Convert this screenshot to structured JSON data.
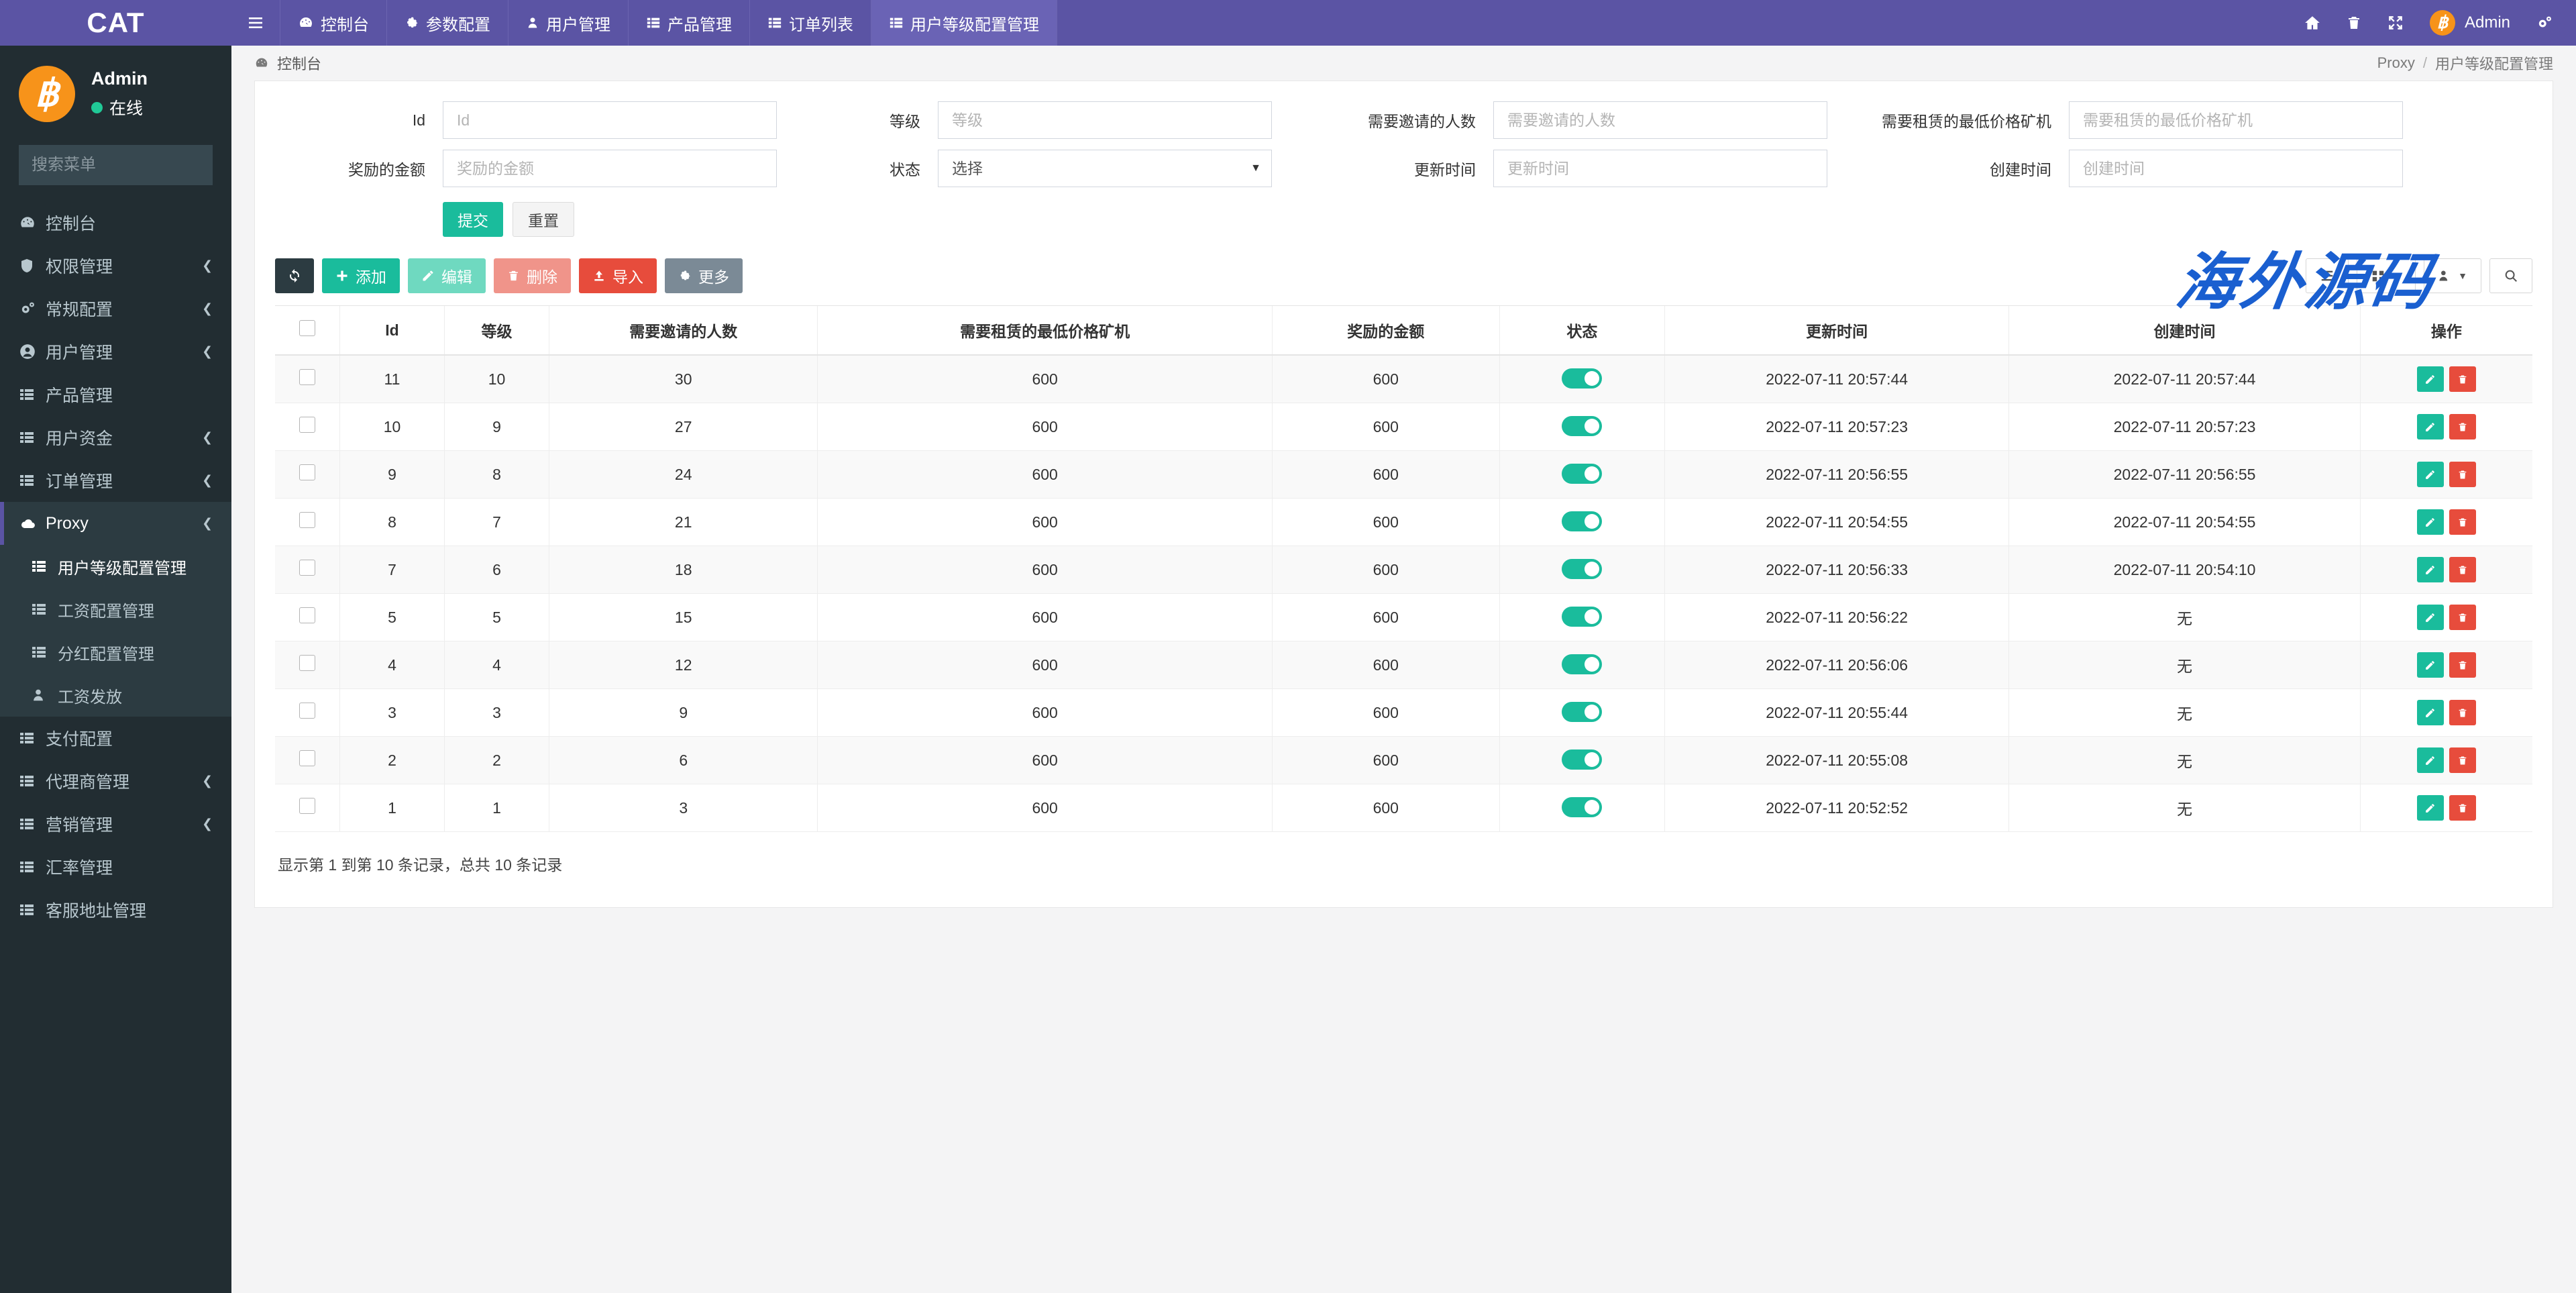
{
  "brand": {
    "title": "CAT"
  },
  "sidebar": {
    "user": {
      "name": "Admin",
      "status": "在线",
      "avatar_icon": "bitcoin-icon"
    },
    "search": {
      "placeholder": "搜索菜单",
      "value": "",
      "icon": "search-icon"
    },
    "items": [
      {
        "label": "控制台",
        "icon": "dashboard-icon",
        "caret": false,
        "active": false
      },
      {
        "label": "权限管理",
        "icon": "shield-icon",
        "caret": true,
        "active": false
      },
      {
        "label": "常规配置",
        "icon": "gears-icon",
        "caret": true,
        "active": false
      },
      {
        "label": "用户管理",
        "icon": "user-circle-icon",
        "caret": true,
        "active": false
      },
      {
        "label": "产品管理",
        "icon": "list-icon",
        "caret": false,
        "active": false
      },
      {
        "label": "用户资金",
        "icon": "list-icon",
        "caret": true,
        "active": false
      },
      {
        "label": "订单管理",
        "icon": "list-icon",
        "caret": true,
        "active": false
      },
      {
        "label": "Proxy",
        "icon": "cloud-icon",
        "caret": true,
        "active": true
      }
    ],
    "submenu": [
      {
        "label": "用户等级配置管理",
        "icon": "list-icon",
        "active": true
      },
      {
        "label": "工资配置管理",
        "icon": "list-icon",
        "active": false
      },
      {
        "label": "分红配置管理",
        "icon": "list-icon",
        "active": false
      },
      {
        "label": "工资发放",
        "icon": "user-icon",
        "active": false
      }
    ],
    "items_after": [
      {
        "label": "支付配置",
        "icon": "list-icon",
        "caret": false,
        "active": false
      },
      {
        "label": "代理商管理",
        "icon": "list-icon",
        "caret": true,
        "active": false
      },
      {
        "label": "营销管理",
        "icon": "list-icon",
        "caret": true,
        "active": false
      },
      {
        "label": "汇率管理",
        "icon": "list-icon",
        "caret": false,
        "active": false
      },
      {
        "label": "客服地址管理",
        "icon": "list-icon",
        "caret": false,
        "active": false
      }
    ]
  },
  "topbar": {
    "hamburger_icon": "hamburger-icon",
    "nav": [
      {
        "label": "控制台",
        "icon": "dashboard-icon",
        "active": false
      },
      {
        "label": "参数配置",
        "icon": "gear-icon",
        "active": false
      },
      {
        "label": "用户管理",
        "icon": "user-icon",
        "active": false
      },
      {
        "label": "产品管理",
        "icon": "list-icon",
        "active": false
      },
      {
        "label": "订单列表",
        "icon": "list-icon",
        "active": false
      },
      {
        "label": "用户等级配置管理",
        "icon": "list-icon",
        "active": true
      }
    ],
    "right": {
      "home_icon": "home-icon",
      "trash_icon": "trash-icon",
      "fullscreen_icon": "fullscreen-icon",
      "username": "Admin",
      "avatar_icon": "bitcoin-icon",
      "settings_icon": "gears-icon"
    }
  },
  "breadcrumb": {
    "icon": "dashboard-icon",
    "current": "控制台",
    "trail": [
      "Proxy",
      "用户等级配置管理"
    ],
    "separator": "/"
  },
  "search_form": {
    "fields": {
      "id": {
        "label": "Id",
        "placeholder": "Id",
        "value": ""
      },
      "level": {
        "label": "等级",
        "placeholder": "等级",
        "value": ""
      },
      "invite_count": {
        "label": "需要邀请的人数",
        "placeholder": "需要邀请的人数",
        "value": ""
      },
      "min_rent_price": {
        "label": "需要租赁的最低价格矿机",
        "placeholder": "需要租赁的最低价格矿机",
        "value": ""
      },
      "reward_amount": {
        "label": "奖励的金额",
        "placeholder": "奖励的金额",
        "value": ""
      },
      "status": {
        "label": "状态",
        "selected": "选择",
        "options": [
          "选择"
        ]
      },
      "update_time": {
        "label": "更新时间",
        "placeholder": "更新时间",
        "value": ""
      },
      "create_time": {
        "label": "创建时间",
        "placeholder": "创建时间",
        "value": ""
      }
    },
    "submit_label": "提交",
    "reset_label": "重置"
  },
  "watermark": {
    "text": "海外源码",
    "color": "#1a5fd0"
  },
  "toolbar": {
    "refresh": {
      "label": "",
      "icon": "refresh-icon"
    },
    "add": {
      "label": "添加",
      "icon": "plus-icon"
    },
    "edit": {
      "label": "编辑",
      "icon": "pencil-icon"
    },
    "delete": {
      "label": "删除",
      "icon": "trash-icon"
    },
    "import": {
      "label": "导入",
      "icon": "upload-icon"
    },
    "more": {
      "label": "更多",
      "icon": "gear-icon"
    },
    "view_list": {
      "icon": "list-view-icon"
    },
    "columns": {
      "icon": "grid-icon"
    },
    "export": {
      "icon": "person-export-icon"
    },
    "search": {
      "icon": "search-icon"
    }
  },
  "table": {
    "columns": [
      "",
      "Id",
      "等级",
      "需要邀请的人数",
      "需要租赁的最低价格矿机",
      "奖励的金额",
      "状态",
      "更新时间",
      "创建时间",
      "操作"
    ],
    "rows": [
      {
        "id": "11",
        "level": "10",
        "invite": "30",
        "min_price": "600",
        "reward": "600",
        "status": true,
        "update_time": "2022-07-11 20:57:44",
        "create_time": "2022-07-11 20:57:44"
      },
      {
        "id": "10",
        "level": "9",
        "invite": "27",
        "min_price": "600",
        "reward": "600",
        "status": true,
        "update_time": "2022-07-11 20:57:23",
        "create_time": "2022-07-11 20:57:23"
      },
      {
        "id": "9",
        "level": "8",
        "invite": "24",
        "min_price": "600",
        "reward": "600",
        "status": true,
        "update_time": "2022-07-11 20:56:55",
        "create_time": "2022-07-11 20:56:55"
      },
      {
        "id": "8",
        "level": "7",
        "invite": "21",
        "min_price": "600",
        "reward": "600",
        "status": true,
        "update_time": "2022-07-11 20:54:55",
        "create_time": "2022-07-11 20:54:55"
      },
      {
        "id": "7",
        "level": "6",
        "invite": "18",
        "min_price": "600",
        "reward": "600",
        "status": true,
        "update_time": "2022-07-11 20:56:33",
        "create_time": "2022-07-11 20:54:10"
      },
      {
        "id": "5",
        "level": "5",
        "invite": "15",
        "min_price": "600",
        "reward": "600",
        "status": true,
        "update_time": "2022-07-11 20:56:22",
        "create_time": "无"
      },
      {
        "id": "4",
        "level": "4",
        "invite": "12",
        "min_price": "600",
        "reward": "600",
        "status": true,
        "update_time": "2022-07-11 20:56:06",
        "create_time": "无"
      },
      {
        "id": "3",
        "level": "3",
        "invite": "9",
        "min_price": "600",
        "reward": "600",
        "status": true,
        "update_time": "2022-07-11 20:55:44",
        "create_time": "无"
      },
      {
        "id": "2",
        "level": "2",
        "invite": "6",
        "min_price": "600",
        "reward": "600",
        "status": true,
        "update_time": "2022-07-11 20:55:08",
        "create_time": "无"
      },
      {
        "id": "1",
        "level": "1",
        "invite": "3",
        "min_price": "600",
        "reward": "600",
        "status": true,
        "update_time": "2022-07-11 20:52:52",
        "create_time": "无"
      }
    ],
    "row_action_edit_icon": "pencil-icon",
    "row_action_delete_icon": "trash-icon",
    "footer_text": "显示第 1 到第 10 条记录，总共 10 条记录"
  }
}
